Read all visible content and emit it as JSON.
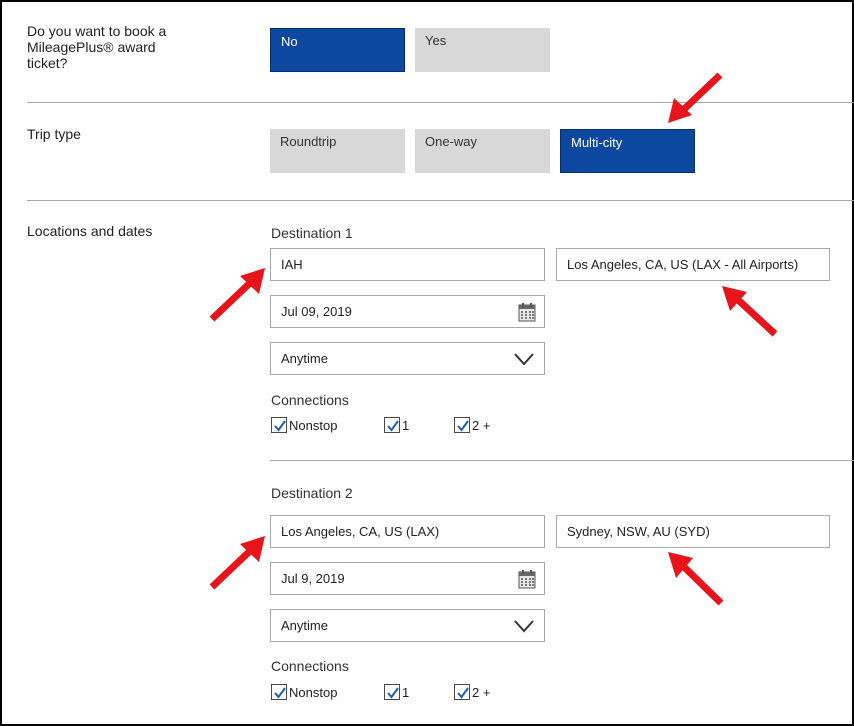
{
  "award_question": {
    "label": "Do you want to book a MileagePlus® award ticket?",
    "options": [
      {
        "label": "No",
        "selected": true
      },
      {
        "label": "Yes",
        "selected": false
      }
    ]
  },
  "trip_type": {
    "label": "Trip type",
    "options": [
      {
        "label": "Roundtrip",
        "selected": false
      },
      {
        "label": "One-way",
        "selected": false
      },
      {
        "label": "Multi-city",
        "selected": true
      }
    ]
  },
  "locations": {
    "label": "Locations and dates",
    "destinations": [
      {
        "title": "Destination 1",
        "from": "IAH",
        "to": "Los Angeles, CA, US (LAX - All Airports)",
        "date": "Jul 09, 2019",
        "time": "Anytime",
        "connections_label": "Connections",
        "connections": [
          {
            "label": "Nonstop",
            "checked": true
          },
          {
            "label": "1",
            "checked": true
          },
          {
            "label": "2 +",
            "checked": true
          }
        ]
      },
      {
        "title": "Destination 2",
        "from": "Los Angeles, CA, US (LAX)",
        "to": "Sydney, NSW, AU (SYD)",
        "date": "Jul 9, 2019",
        "time": "Anytime",
        "connections_label": "Connections",
        "connections": [
          {
            "label": "Nonstop",
            "checked": true
          },
          {
            "label": "1",
            "checked": true
          },
          {
            "label": "2 +",
            "checked": true
          }
        ]
      }
    ]
  },
  "colors": {
    "selected": "#0c48a0",
    "unselected": "#d8d8d8",
    "arrow": "#e8141c",
    "check": "#1f5fb5"
  },
  "icons": [
    "calendar-icon",
    "chevron-down-icon",
    "checkmark-icon",
    "red-arrow-icon"
  ]
}
